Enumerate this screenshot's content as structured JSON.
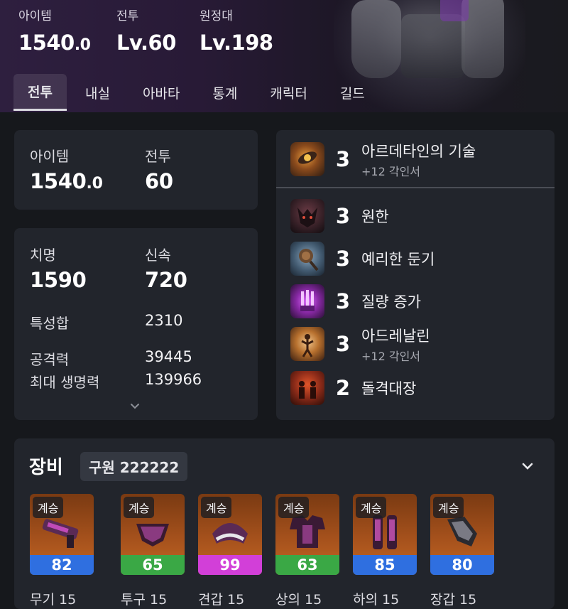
{
  "header": {
    "stats": [
      {
        "label": "아이템",
        "value": "1540",
        "decimal": ".0"
      },
      {
        "label": "전투",
        "value": "Lv.60",
        "decimal": ""
      },
      {
        "label": "원정대",
        "value": "Lv.198",
        "decimal": ""
      }
    ],
    "tabs": [
      "전투",
      "내실",
      "아바타",
      "통계",
      "캐릭터",
      "길드"
    ],
    "active_tab": "전투"
  },
  "levels_card": {
    "item_label": "아이템",
    "item_value": "1540",
    "item_decimal": ".0",
    "combat_label": "전투",
    "combat_value": "60"
  },
  "stats_card": {
    "crit_label": "치명",
    "crit_value": "1590",
    "swift_label": "신속",
    "swift_value": "720",
    "trait_sum_label": "특성합",
    "trait_sum_value": "2310",
    "attack_label": "공격력",
    "attack_value": "39445",
    "max_hp_label": "최대 생명력",
    "max_hp_value": "139966",
    "expand_icon": "chevron-down-icon"
  },
  "engravings": [
    {
      "count": "3",
      "name": "아르데타인의 기술",
      "sub": "+12 각인서",
      "icon": "drone-gear-icon",
      "color": "#a35a24"
    },
    {
      "count": "3",
      "name": "원한",
      "sub": "",
      "icon": "beast-face-icon",
      "color": "#4b2a35"
    },
    {
      "count": "3",
      "name": "예리한 둔기",
      "sub": "",
      "icon": "spiked-mace-icon",
      "color": "#3f5568"
    },
    {
      "count": "3",
      "name": "질량 증가",
      "sub": "",
      "icon": "crystal-hand-icon",
      "color": "#7a2a8f"
    },
    {
      "count": "3",
      "name": "아드레날린",
      "sub": "+12 각인서",
      "icon": "rage-figure-icon",
      "color": "#8a4a28"
    },
    {
      "count": "2",
      "name": "돌격대장",
      "sub": "",
      "icon": "charging-warrior-icon",
      "color": "#7a2a20"
    }
  ],
  "equipment": {
    "title": "장비",
    "badge": "구원 222222",
    "collapse_icon": "chevron-down-icon",
    "items": [
      {
        "tier": "계승",
        "quality": "82",
        "quality_color": "#2f6fe0",
        "name": "무기 15",
        "icon": "launcher-weapon-icon"
      },
      {
        "tier": "계승",
        "quality": "65",
        "quality_color": "#3aa845",
        "name": "투구 15",
        "icon": "helmet-icon"
      },
      {
        "tier": "계승",
        "quality": "99",
        "quality_color": "#d23fd8",
        "name": "견갑 15",
        "icon": "shoulder-guard-icon"
      },
      {
        "tier": "계승",
        "quality": "63",
        "quality_color": "#3aa845",
        "name": "상의 15",
        "icon": "chest-armor-icon"
      },
      {
        "tier": "계승",
        "quality": "85",
        "quality_color": "#2f6fe0",
        "name": "하의 15",
        "icon": "leg-armor-icon"
      },
      {
        "tier": "계승",
        "quality": "80",
        "quality_color": "#2f6fe0",
        "name": "장갑 15",
        "icon": "gauntlet-icon"
      }
    ]
  }
}
